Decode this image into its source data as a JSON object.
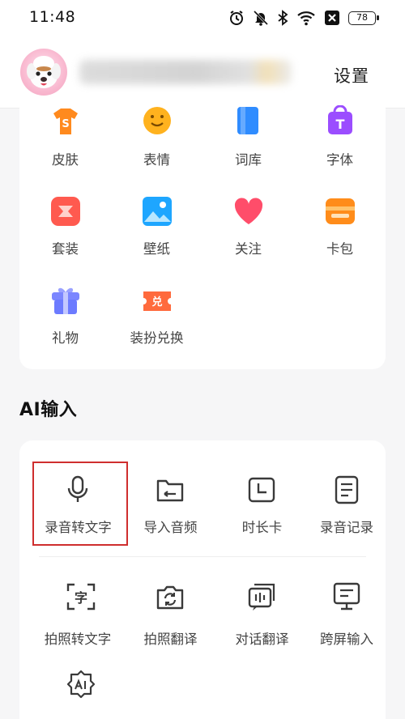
{
  "status_bar": {
    "time": "11:48",
    "battery": "78",
    "icons": [
      "alarm-icon",
      "mute-icon",
      "bluetooth-icon",
      "wifi-icon",
      "sim-off-icon",
      "battery-icon"
    ]
  },
  "header": {
    "settings_label": "设置"
  },
  "personalize": {
    "items": [
      {
        "label": "皮肤",
        "icon": "shirt-icon",
        "color": "#ff8a1e"
      },
      {
        "label": "表情",
        "icon": "smiley-icon",
        "color": "#ffb21e"
      },
      {
        "label": "词库",
        "icon": "book-icon",
        "color": "#2f8cff"
      },
      {
        "label": "字体",
        "icon": "font-bag-icon",
        "color": "#9b4dff"
      },
      {
        "label": "套装",
        "icon": "suit-icon",
        "color": "#ff5a4f"
      },
      {
        "label": "壁纸",
        "icon": "wallpaper-icon",
        "color": "#1ea6ff"
      },
      {
        "label": "关注",
        "icon": "heart-icon",
        "color": "#ff4d6a"
      },
      {
        "label": "卡包",
        "icon": "card-wallet-icon",
        "color": "#ff8c1a"
      },
      {
        "label": "礼物",
        "icon": "gift-icon",
        "color": "#6c7bff"
      },
      {
        "label": "装扮兑换",
        "icon": "redeem-ticket-icon",
        "color": "#ff6a3d",
        "icon_text": "兑"
      }
    ]
  },
  "ai_section": {
    "title": "AI输入",
    "row1": [
      {
        "label": "录音转文字",
        "icon": "microphone-icon"
      },
      {
        "label": "导入音频",
        "icon": "folder-import-icon"
      },
      {
        "label": "时长卡",
        "icon": "clock-card-icon"
      },
      {
        "label": "录音记录",
        "icon": "record-list-icon"
      }
    ],
    "row2": [
      {
        "label": "拍照转文字",
        "icon": "scan-text-icon",
        "icon_text": "字"
      },
      {
        "label": "拍照翻译",
        "icon": "camera-translate-icon"
      },
      {
        "label": "对话翻译",
        "icon": "chat-translate-icon"
      },
      {
        "label": "跨屏输入",
        "icon": "monitor-input-icon"
      }
    ],
    "row3": [
      {
        "label": "",
        "icon": "ai-badge-icon"
      }
    ]
  },
  "colors": {
    "highlight_border": "#cf2e2e",
    "icon_stroke": "#3a3a3a"
  }
}
